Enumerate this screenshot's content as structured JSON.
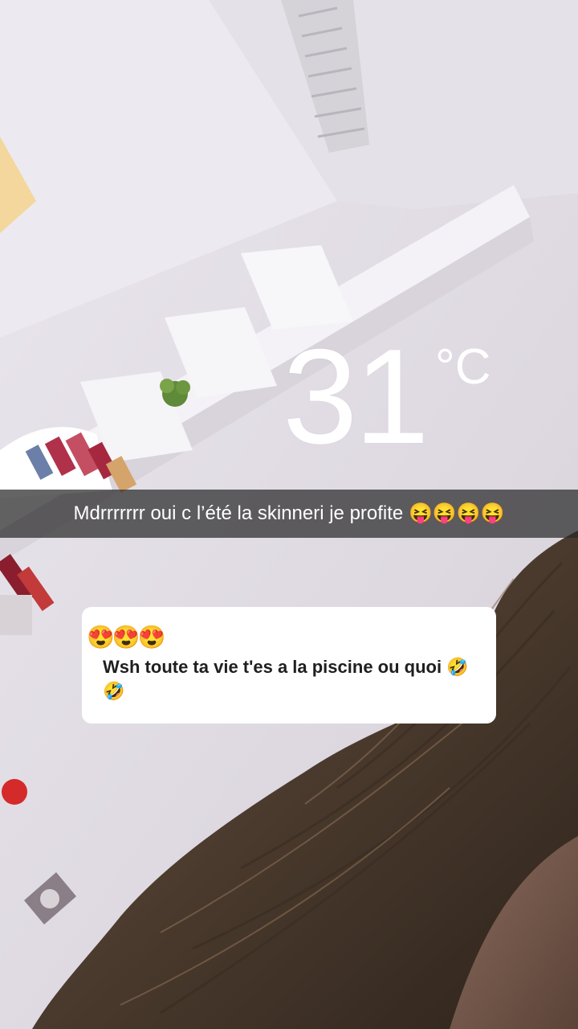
{
  "weather_sticker": {
    "temperature": "31",
    "unit": "°C"
  },
  "caption": {
    "text": "Mdrrrrrrr oui c l’été la skinneri je profite 😝😝😝😝"
  },
  "reply_card": {
    "emojis": "😍😍😍",
    "message": "Wsh toute ta vie t'es a la piscine ou quoi 🤣🤣"
  }
}
